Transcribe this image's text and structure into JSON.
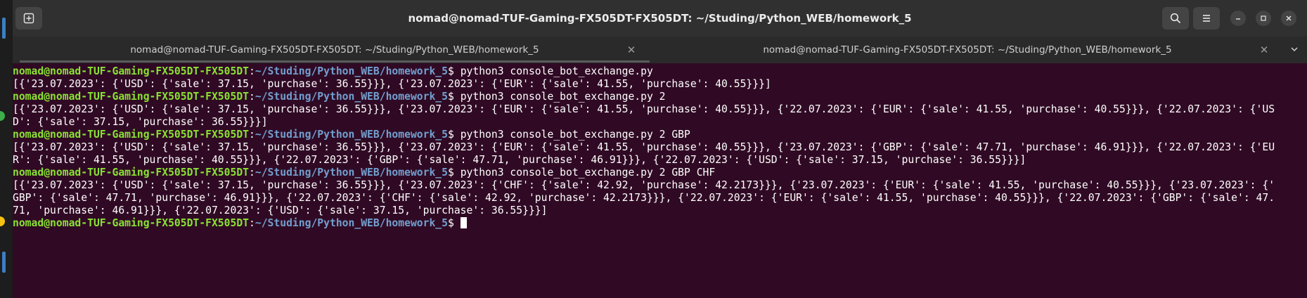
{
  "window": {
    "title": "nomad@nomad-TUF-Gaming-FX505DT-FX505DT: ~/Studing/Python_WEB/homework_5"
  },
  "tabs": [
    {
      "label": "nomad@nomad-TUF-Gaming-FX505DT-FX505DT: ~/Studing/Python_WEB/homework_5",
      "active": true
    },
    {
      "label": "nomad@nomad-TUF-Gaming-FX505DT-FX505DT: ~/Studing/Python_WEB/homework_5",
      "active": false
    }
  ],
  "prompt": {
    "user_host": "nomad@nomad-TUF-Gaming-FX505DT-FX505DT",
    "sep": ":",
    "path": "~/Studing/Python_WEB/homework_5",
    "symbol": "$ "
  },
  "session": {
    "cmd1": "python3 console_bot_exchange.py",
    "out1_1": "[{'23.07.2023': {'USD': {'sale': 37.15, 'purchase': 36.55}}}, {'23.07.2023': {'EUR': {'sale': 41.55, 'purchase': 40.55}}}]",
    "cmd2": "python3 console_bot_exchange.py 2",
    "out2_1": "[{'23.07.2023': {'USD': {'sale': 37.15, 'purchase': 36.55}}}, {'23.07.2023': {'EUR': {'sale': 41.55, 'purchase': 40.55}}}, {'22.07.2023': {'EUR': {'sale': 41.55, 'purchase': 40.55}}}, {'22.07.2023': {'US",
    "out2_2": "D': {'sale': 37.15, 'purchase': 36.55}}}]",
    "cmd3": "python3 console_bot_exchange.py 2 GBP",
    "out3_1": "[{'23.07.2023': {'USD': {'sale': 37.15, 'purchase': 36.55}}}, {'23.07.2023': {'EUR': {'sale': 41.55, 'purchase': 40.55}}}, {'23.07.2023': {'GBP': {'sale': 47.71, 'purchase': 46.91}}}, {'22.07.2023': {'EU",
    "out3_2": "R': {'sale': 41.55, 'purchase': 40.55}}}, {'22.07.2023': {'GBP': {'sale': 47.71, 'purchase': 46.91}}}, {'22.07.2023': {'USD': {'sale': 37.15, 'purchase': 36.55}}}]",
    "cmd4": "python3 console_bot_exchange.py 2 GBP CHF",
    "out4_1": "[{'23.07.2023': {'USD': {'sale': 37.15, 'purchase': 36.55}}}, {'23.07.2023': {'CHF': {'sale': 42.92, 'purchase': 42.2173}}}, {'23.07.2023': {'EUR': {'sale': 41.55, 'purchase': 40.55}}}, {'23.07.2023': {'",
    "out4_2": "GBP': {'sale': 47.71, 'purchase': 46.91}}}, {'22.07.2023': {'CHF': {'sale': 42.92, 'purchase': 42.2173}}}, {'22.07.2023': {'EUR': {'sale': 41.55, 'purchase': 40.55}}}, {'22.07.2023': {'GBP': {'sale': 47.",
    "out4_3": "71, 'purchase': 46.91}}}, {'22.07.2023': {'USD': {'sale': 37.15, 'purchase': 36.55}}}]"
  },
  "icons": {
    "new_tab": "new-tab-icon",
    "search": "search-icon",
    "menu": "hamburger-menu-icon",
    "minimize": "minimize-icon",
    "maximize": "maximize-icon",
    "close": "close-icon",
    "tab_close": "tab-close-icon",
    "tab_list": "chevron-down-icon"
  },
  "colors": {
    "terminal_bg": "#300a24",
    "prompt_user": "#8ae234",
    "prompt_path": "#729fcf",
    "text": "#ffffff"
  }
}
